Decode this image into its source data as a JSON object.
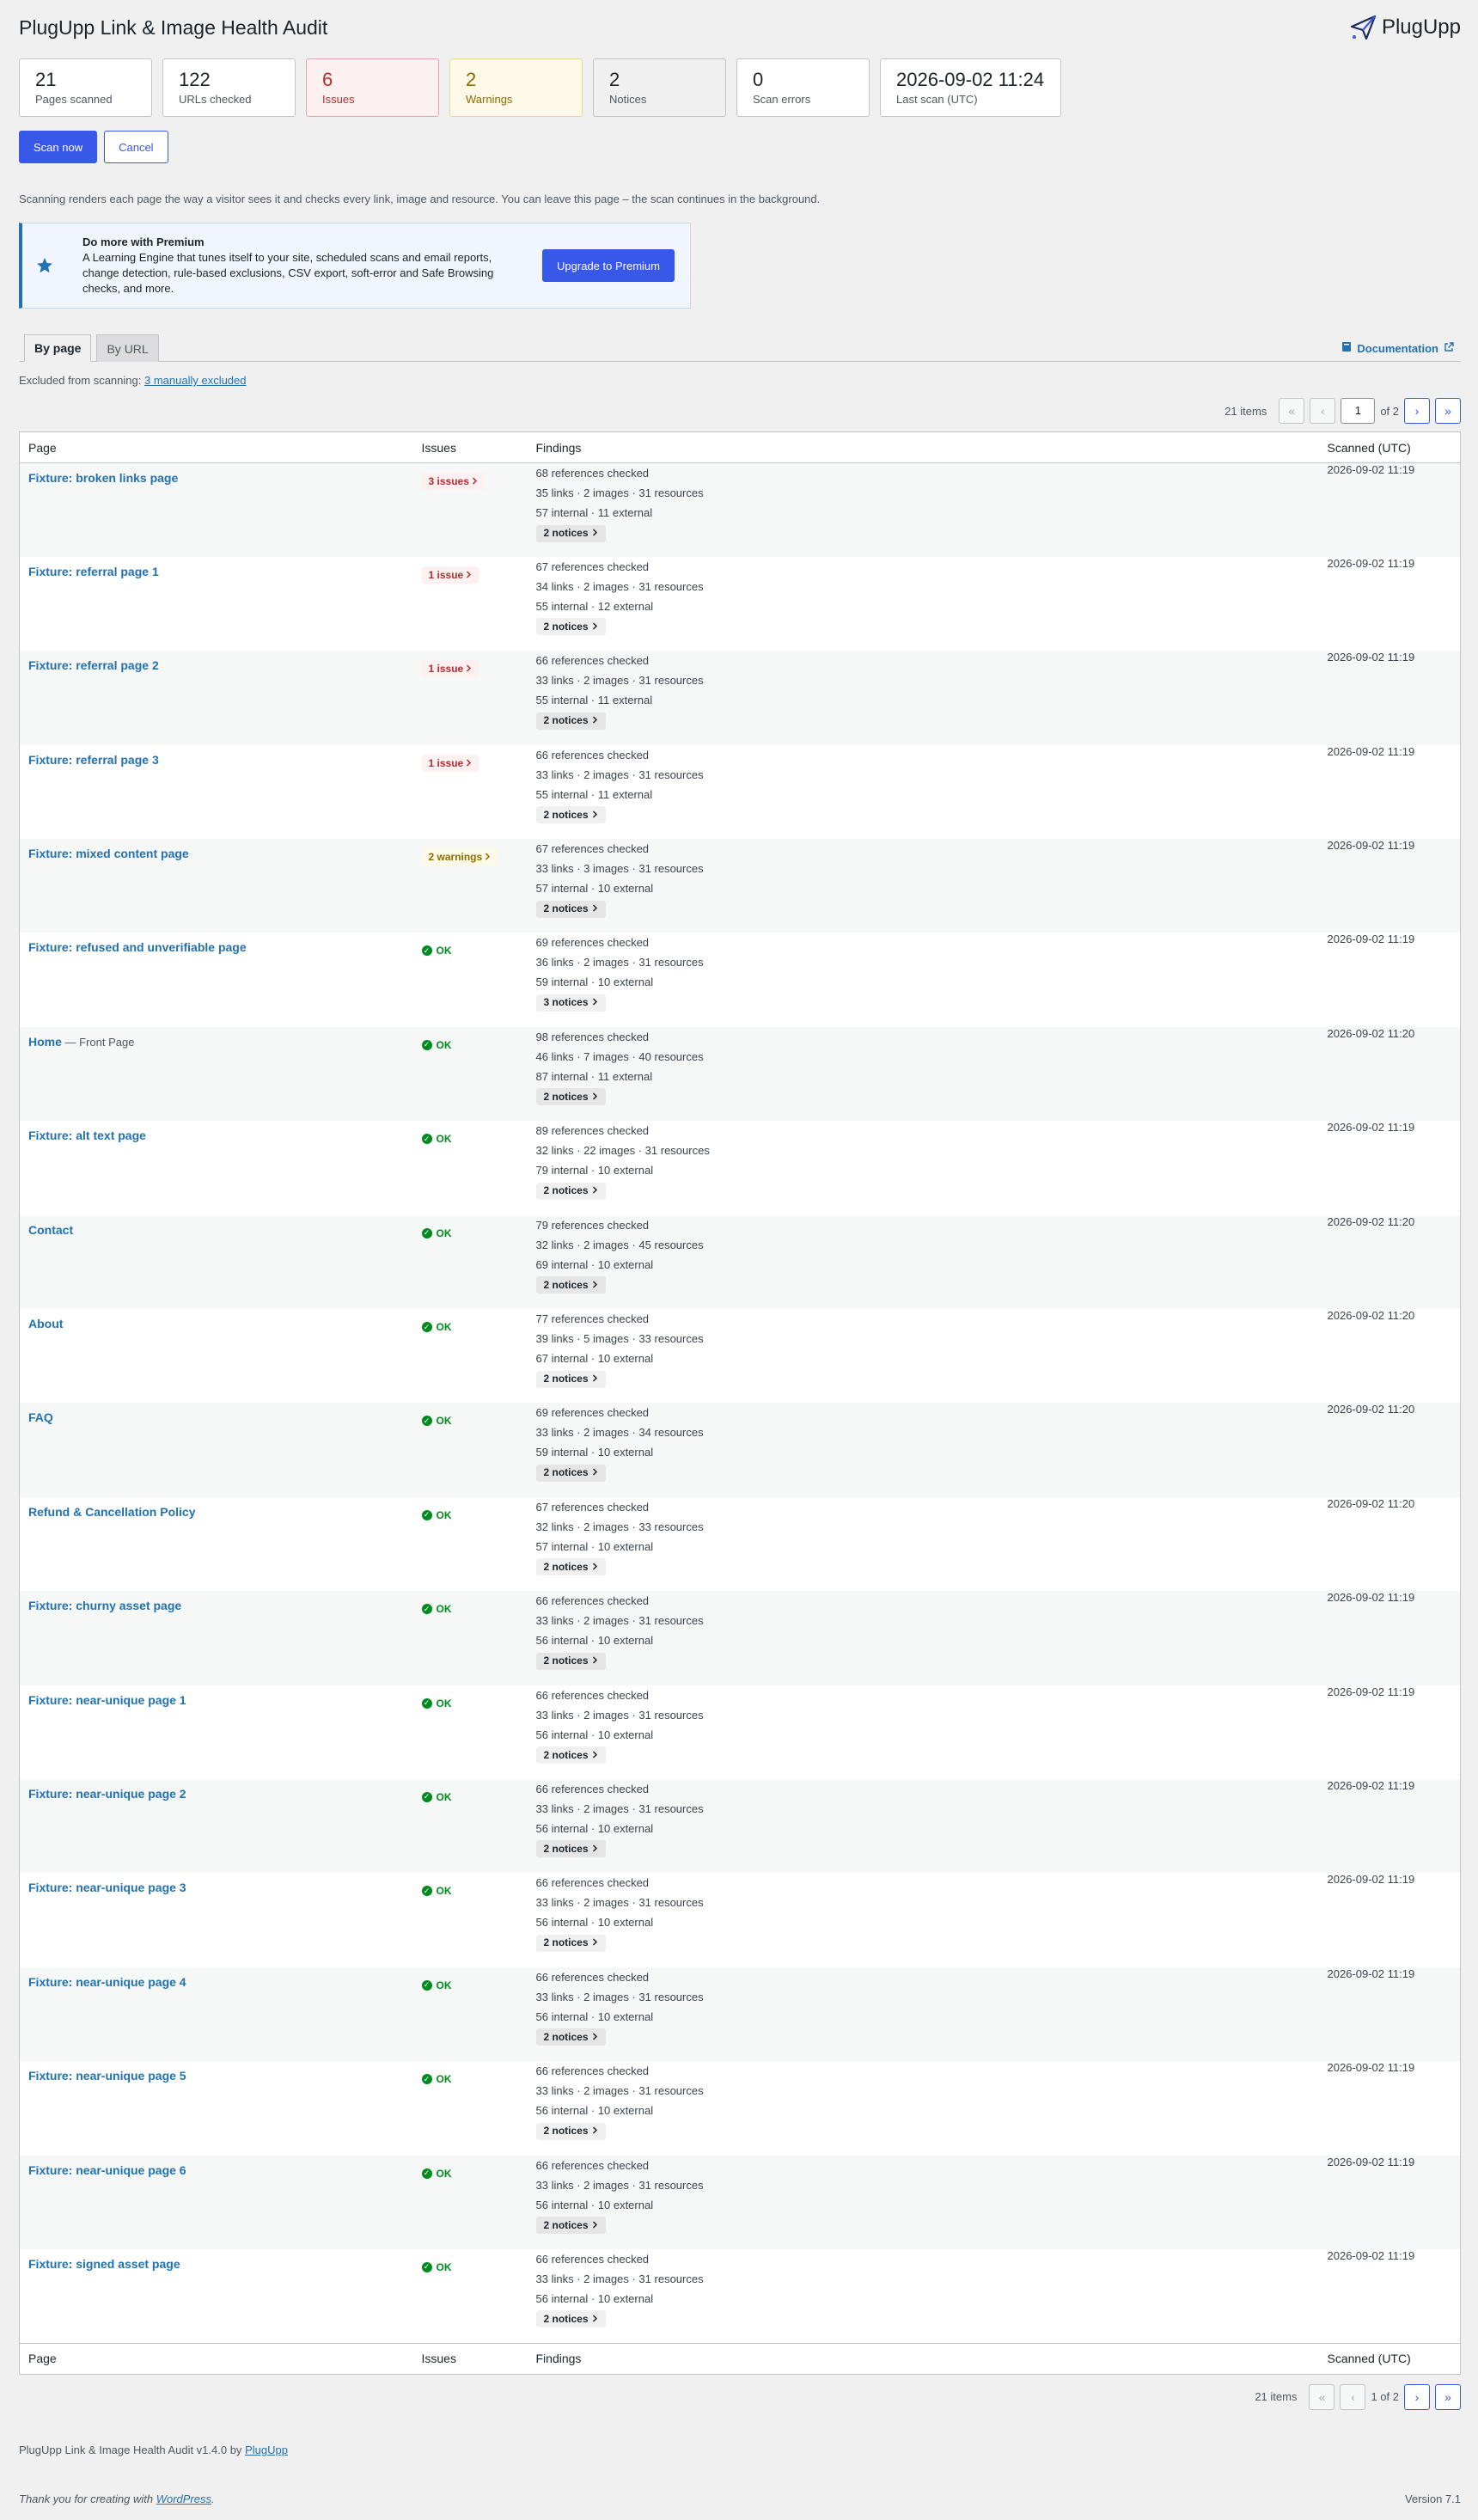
{
  "header": {
    "title": "PlugUpp Link & Image Health Audit",
    "brand": "PlugUpp"
  },
  "stats": [
    {
      "value": "21",
      "label": "Pages scanned"
    },
    {
      "value": "122",
      "label": "URLs checked"
    },
    {
      "value": "6",
      "label": "Issues"
    },
    {
      "value": "2",
      "label": "Warnings"
    },
    {
      "value": "2",
      "label": "Notices"
    },
    {
      "value": "0",
      "label": "Scan errors"
    },
    {
      "value": "2026-09-02 11:24",
      "label": "Last scan (UTC)"
    }
  ],
  "actions": {
    "scan": "Scan now",
    "cancel": "Cancel"
  },
  "help_text": "Scanning renders each page the way a visitor sees it and checks every link, image and resource. You can leave this page – the scan continues in the background.",
  "promo": {
    "title": "Do more with Premium",
    "description": "A Learning Engine that tunes itself to your site, scheduled scans and email reports, change detection, rule-based exclusions, CSV export, soft-error and Safe Browsing checks, and more.",
    "button": "Upgrade to Premium"
  },
  "tabs": [
    "By page",
    "By URL"
  ],
  "documentation": "Documentation",
  "excluded": {
    "prefix": "Excluded from scanning:",
    "link": "3 manually excluded"
  },
  "pager_top": {
    "items": "21 items",
    "first": "«",
    "prev": "‹",
    "current": "1",
    "of": "of 2",
    "next": "›",
    "last": "»"
  },
  "pager_bottom": {
    "items": "21 items",
    "first": "«",
    "prev": "‹",
    "status": "1 of 2",
    "next": "›",
    "last": "»"
  },
  "columns": {
    "page": "Page",
    "issues": "Issues",
    "findings": "Findings",
    "scanned": "Scanned (UTC)"
  },
  "rows": [
    {
      "page": "Fixture: broken links page",
      "suffix": "",
      "status": "err",
      "badge": "3 issues",
      "f1": "68 references checked",
      "f2": "35 links · 2 images · 31 resources",
      "f3": "57 internal · 11 external",
      "notices": "2 notices",
      "scanned": "2026-09-02 11:19"
    },
    {
      "page": "Fixture: referral page 1",
      "suffix": "",
      "status": "err",
      "badge": "1 issue",
      "f1": "67 references checked",
      "f2": "34 links · 2 images · 31 resources",
      "f3": "55 internal · 12 external",
      "notices": "2 notices",
      "scanned": "2026-09-02 11:19"
    },
    {
      "page": "Fixture: referral page 2",
      "suffix": "",
      "status": "err",
      "badge": "1 issue",
      "f1": "66 references checked",
      "f2": "33 links · 2 images · 31 resources",
      "f3": "55 internal · 11 external",
      "notices": "2 notices",
      "scanned": "2026-09-02 11:19"
    },
    {
      "page": "Fixture: referral page 3",
      "suffix": "",
      "status": "err",
      "badge": "1 issue",
      "f1": "66 references checked",
      "f2": "33 links · 2 images · 31 resources",
      "f3": "55 internal · 11 external",
      "notices": "2 notices",
      "scanned": "2026-09-02 11:19"
    },
    {
      "page": "Fixture: mixed content page",
      "suffix": "",
      "status": "warn",
      "badge": "2 warnings",
      "f1": "67 references checked",
      "f2": "33 links · 3 images · 31 resources",
      "f3": "57 internal · 10 external",
      "notices": "2 notices",
      "scanned": "2026-09-02 11:19"
    },
    {
      "page": "Fixture: refused and unverifiable page",
      "suffix": "",
      "status": "ok",
      "badge": "OK",
      "f1": "69 references checked",
      "f2": "36 links · 2 images · 31 resources",
      "f3": "59 internal · 10 external",
      "notices": "3 notices",
      "scanned": "2026-09-02 11:19"
    },
    {
      "page": "Home",
      "suffix": " — Front Page",
      "status": "ok",
      "badge": "OK",
      "f1": "98 references checked",
      "f2": "46 links · 7 images · 40 resources",
      "f3": "87 internal · 11 external",
      "notices": "2 notices",
      "scanned": "2026-09-02 11:20"
    },
    {
      "page": "Fixture: alt text page",
      "suffix": "",
      "status": "ok",
      "badge": "OK",
      "f1": "89 references checked",
      "f2": "32 links · 22 images · 31 resources",
      "f3": "79 internal · 10 external",
      "notices": "2 notices",
      "scanned": "2026-09-02 11:19"
    },
    {
      "page": "Contact",
      "suffix": "",
      "status": "ok",
      "badge": "OK",
      "f1": "79 references checked",
      "f2": "32 links · 2 images · 45 resources",
      "f3": "69 internal · 10 external",
      "notices": "2 notices",
      "scanned": "2026-09-02 11:20"
    },
    {
      "page": "About",
      "suffix": "",
      "status": "ok",
      "badge": "OK",
      "f1": "77 references checked",
      "f2": "39 links · 5 images · 33 resources",
      "f3": "67 internal · 10 external",
      "notices": "2 notices",
      "scanned": "2026-09-02 11:20"
    },
    {
      "page": "FAQ",
      "suffix": "",
      "status": "ok",
      "badge": "OK",
      "f1": "69 references checked",
      "f2": "33 links · 2 images · 34 resources",
      "f3": "59 internal · 10 external",
      "notices": "2 notices",
      "scanned": "2026-09-02 11:20"
    },
    {
      "page": "Refund & Cancellation Policy",
      "suffix": "",
      "status": "ok",
      "badge": "OK",
      "f1": "67 references checked",
      "f2": "32 links · 2 images · 33 resources",
      "f3": "57 internal · 10 external",
      "notices": "2 notices",
      "scanned": "2026-09-02 11:20"
    },
    {
      "page": "Fixture: churny asset page",
      "suffix": "",
      "status": "ok",
      "badge": "OK",
      "f1": "66 references checked",
      "f2": "33 links · 2 images · 31 resources",
      "f3": "56 internal · 10 external",
      "notices": "2 notices",
      "scanned": "2026-09-02 11:19"
    },
    {
      "page": "Fixture: near-unique page 1",
      "suffix": "",
      "status": "ok",
      "badge": "OK",
      "f1": "66 references checked",
      "f2": "33 links · 2 images · 31 resources",
      "f3": "56 internal · 10 external",
      "notices": "2 notices",
      "scanned": "2026-09-02 11:19"
    },
    {
      "page": "Fixture: near-unique page 2",
      "suffix": "",
      "status": "ok",
      "badge": "OK",
      "f1": "66 references checked",
      "f2": "33 links · 2 images · 31 resources",
      "f3": "56 internal · 10 external",
      "notices": "2 notices",
      "scanned": "2026-09-02 11:19"
    },
    {
      "page": "Fixture: near-unique page 3",
      "suffix": "",
      "status": "ok",
      "badge": "OK",
      "f1": "66 references checked",
      "f2": "33 links · 2 images · 31 resources",
      "f3": "56 internal · 10 external",
      "notices": "2 notices",
      "scanned": "2026-09-02 11:19"
    },
    {
      "page": "Fixture: near-unique page 4",
      "suffix": "",
      "status": "ok",
      "badge": "OK",
      "f1": "66 references checked",
      "f2": "33 links · 2 images · 31 resources",
      "f3": "56 internal · 10 external",
      "notices": "2 notices",
      "scanned": "2026-09-02 11:19"
    },
    {
      "page": "Fixture: near-unique page 5",
      "suffix": "",
      "status": "ok",
      "badge": "OK",
      "f1": "66 references checked",
      "f2": "33 links · 2 images · 31 resources",
      "f3": "56 internal · 10 external",
      "notices": "2 notices",
      "scanned": "2026-09-02 11:19"
    },
    {
      "page": "Fixture: near-unique page 6",
      "suffix": "",
      "status": "ok",
      "badge": "OK",
      "f1": "66 references checked",
      "f2": "33 links · 2 images · 31 resources",
      "f3": "56 internal · 10 external",
      "notices": "2 notices",
      "scanned": "2026-09-02 11:19"
    },
    {
      "page": "Fixture: signed asset page",
      "suffix": "",
      "status": "ok",
      "badge": "OK",
      "f1": "66 references checked",
      "f2": "33 links · 2 images · 31 resources",
      "f3": "56 internal · 10 external",
      "notices": "2 notices",
      "scanned": "2026-09-02 11:19"
    }
  ],
  "footer": {
    "credit_prefix": "PlugUpp Link & Image Health Audit v1.4.0 by",
    "credit_link": "PlugUpp",
    "thanks_prefix": "Thank you for creating with",
    "thanks_link": "WordPress",
    "thanks_suffix": ".",
    "version": "Version 7.1"
  },
  "colors": {
    "accent": "#3858e9",
    "link": "#2271b1",
    "error": "#b32d2e",
    "warning": "#8a6d00",
    "ok": "#008a20"
  },
  "icons": {
    "brand": "paper-plane-icon",
    "promo": "star-icon",
    "docs": "book-icon",
    "external": "external-link-icon",
    "chevron": "chevron-right-icon",
    "ok": "check-circle-icon"
  }
}
